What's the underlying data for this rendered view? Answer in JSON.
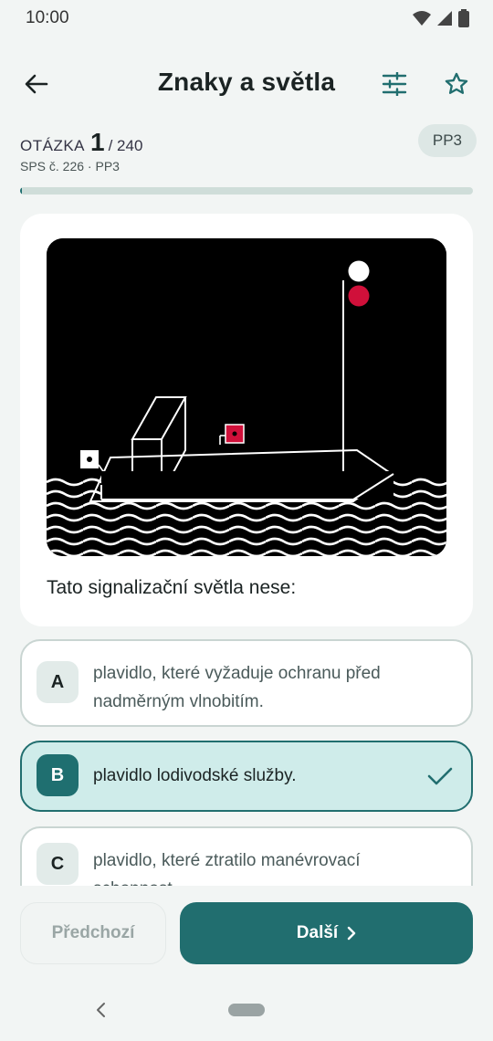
{
  "status": {
    "time": "10:00"
  },
  "header": {
    "title": "Znaky a světla"
  },
  "question": {
    "label": "OTÁZKA",
    "number": "1",
    "total": "/ 240",
    "subtitle": "SPS č. 226 · PP3",
    "badge": "PP3",
    "progress": 0.004,
    "text": "Tato signalizační světla nese:"
  },
  "answers": [
    {
      "letter": "A",
      "text": "plavidlo, které vyžaduje ochranu před nadměrným vlnobitím.",
      "selected": false
    },
    {
      "letter": "B",
      "text": "plavidlo lodivodské služby.",
      "selected": true
    },
    {
      "letter": "C",
      "text": "plavidlo, které ztratilo manévrovací schopnost.",
      "selected": false
    }
  ],
  "buttons": {
    "prev": "Předchozí",
    "next": "Další"
  },
  "colors": {
    "accent": "#216e6f",
    "selected_bg": "#cfecea",
    "light_red": "#d0103a",
    "light_green": "#0a8a3a",
    "light_white": "#ffffff"
  }
}
